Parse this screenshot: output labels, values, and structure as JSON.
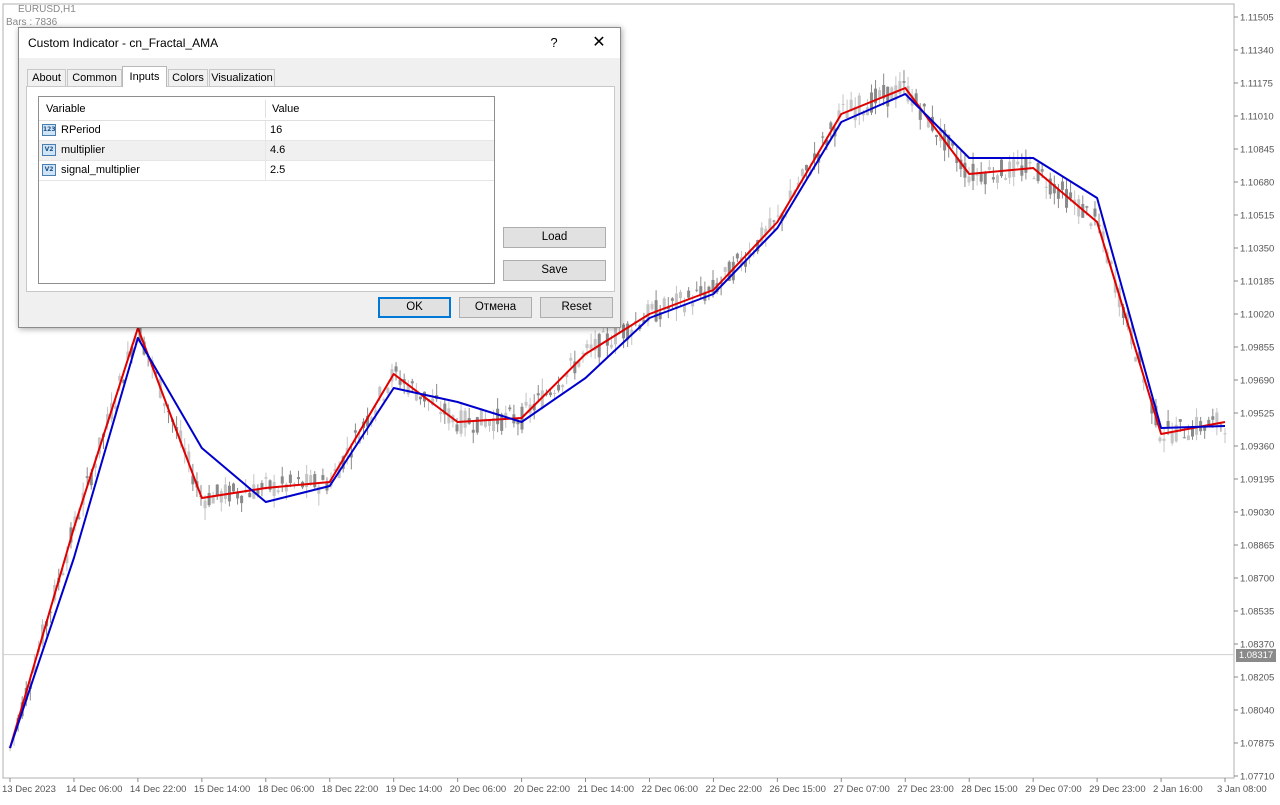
{
  "chart": {
    "symbol": "EURUSD,H1",
    "bars": "Bars : 7836",
    "current_price": "1.08317",
    "price_levels": [
      "1.11505",
      "1.11340",
      "1.11175",
      "1.11010",
      "1.10845",
      "1.10680",
      "1.10515",
      "1.10350",
      "1.10185",
      "1.10020",
      "1.09855",
      "1.09690",
      "1.09525",
      "1.09360",
      "1.09195",
      "1.09030",
      "1.08865",
      "1.08700",
      "1.08535",
      "1.08370",
      "1.08205",
      "1.08040",
      "1.07875",
      "1.07710"
    ],
    "time_labels": [
      "13 Dec 2023",
      "14 Dec 06:00",
      "14 Dec 22:00",
      "15 Dec 14:00",
      "18 Dec 06:00",
      "18 Dec 22:00",
      "19 Dec 14:00",
      "20 Dec 06:00",
      "20 Dec 22:00",
      "21 Dec 14:00",
      "22 Dec 06:00",
      "22 Dec 22:00",
      "26 Dec 15:00",
      "27 Dec 07:00",
      "27 Dec 23:00",
      "28 Dec 15:00",
      "29 Dec 07:00",
      "29 Dec 23:00",
      "2 Jan 16:00",
      "3 Jan 08:00"
    ],
    "colors": {
      "fast_line": "#e00000",
      "slow_line": "#0000cc",
      "candle": "#8a8a8a",
      "candle_up": "#c4c4c4"
    }
  },
  "chart_data": {
    "type": "line",
    "title": "",
    "x": [
      "13 Dec 2023",
      "14 Dec 06:00",
      "14 Dec 22:00",
      "15 Dec 14:00",
      "18 Dec 06:00",
      "18 Dec 22:00",
      "19 Dec 14:00",
      "20 Dec 06:00",
      "20 Dec 22:00",
      "21 Dec 14:00",
      "22 Dec 06:00",
      "22 Dec 22:00",
      "26 Dec 15:00",
      "27 Dec 07:00",
      "27 Dec 23:00",
      "28 Dec 15:00",
      "29 Dec 07:00",
      "29 Dec 23:00",
      "2 Jan 16:00",
      "3 Jan 08:00"
    ],
    "series": [
      {
        "values": [
          1.0785,
          1.0895,
          1.0995,
          1.091,
          1.0915,
          1.0918,
          1.0972,
          1.0948,
          1.095,
          1.0982,
          1.1002,
          1.1014,
          1.1048,
          1.1102,
          1.1115,
          1.1072,
          1.1075,
          1.1048,
          1.0942,
          1.0948
        ],
        "color": "#e00000"
      },
      {
        "values": [
          1.0785,
          1.088,
          1.099,
          1.0935,
          1.0908,
          1.0916,
          1.0965,
          1.0958,
          1.0948,
          1.097,
          1.1,
          1.1012,
          1.1045,
          1.1098,
          1.1112,
          1.108,
          1.108,
          1.106,
          1.0945,
          1.0946
        ],
        "color": "#0000cc"
      }
    ],
    "ylim": [
      1.0771,
      1.11505
    ]
  },
  "dialog": {
    "title": "Custom Indicator - cn_Fractal_AMA",
    "help_label": "?",
    "close_label": "✕",
    "tabs": [
      "About",
      "Common",
      "Inputs",
      "Colors",
      "Visualization"
    ],
    "active_tab": "Inputs",
    "columns": {
      "variable": "Variable",
      "value": "Value"
    },
    "rows": [
      {
        "icon": "int-icon",
        "icon_text": "123",
        "name": "RPeriod",
        "value": "16"
      },
      {
        "icon": "double-icon",
        "icon_text": "V2",
        "name": "multiplier",
        "value": "4.6"
      },
      {
        "icon": "double-icon",
        "icon_text": "V2",
        "name": "signal_multiplier",
        "value": "2.5"
      }
    ],
    "buttons": {
      "load": "Load",
      "save": "Save",
      "ok": "OK",
      "cancel": "Отмена",
      "reset": "Reset"
    }
  }
}
